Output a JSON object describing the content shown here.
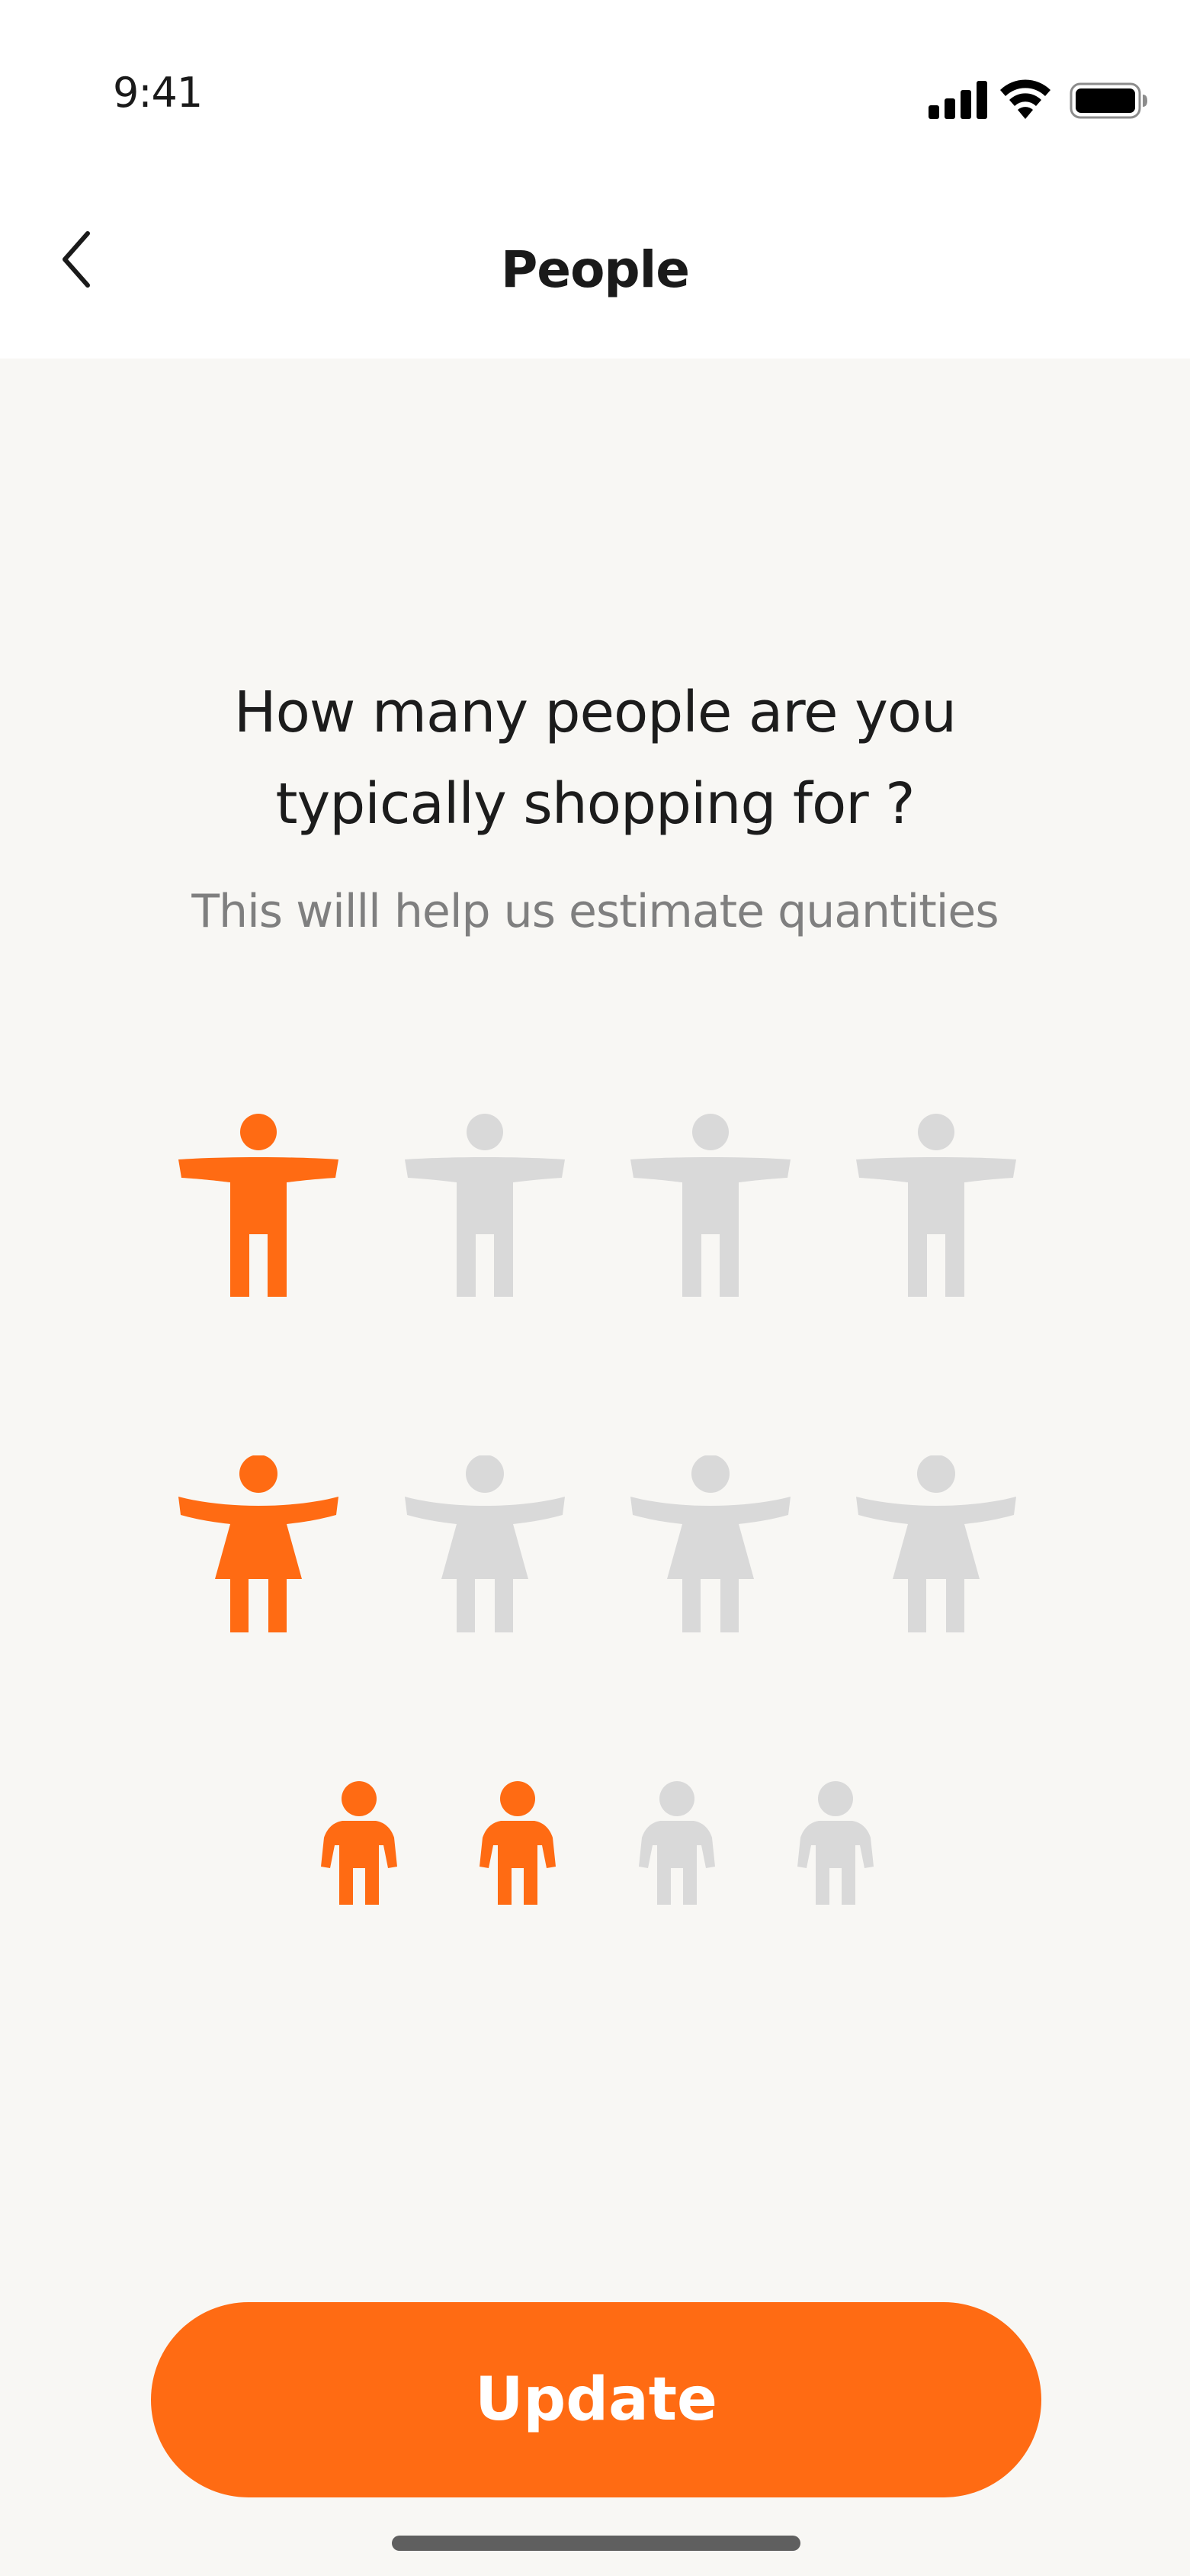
{
  "status_bar": {
    "time": "9:41",
    "icons": [
      "signal-icon",
      "wifi-icon",
      "battery-icon"
    ]
  },
  "header": {
    "back_icon": "chevron-left-icon",
    "title": "People"
  },
  "main": {
    "question_line1": "How many people are you",
    "question_line2": "typically shopping for ?",
    "subtitle": "This willl help us estimate quantities",
    "rows": [
      {
        "type": "man",
        "icon": "man-icon",
        "total": 4,
        "selected": 1
      },
      {
        "type": "woman",
        "icon": "woman-icon",
        "total": 4,
        "selected": 1
      },
      {
        "type": "child",
        "icon": "child-icon",
        "total": 4,
        "selected": 2
      }
    ],
    "update_label": "Update"
  },
  "colors": {
    "accent": "#ff6b13",
    "inactive": "#d9d9d9",
    "background": "#f8f7f4",
    "subtitle": "#7f7f7f"
  }
}
